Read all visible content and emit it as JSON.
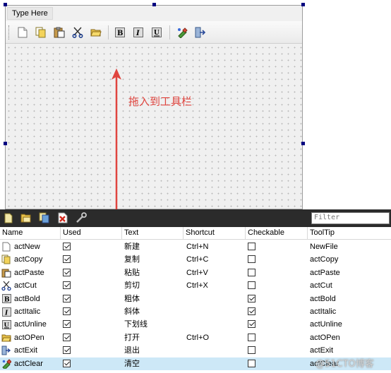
{
  "designer": {
    "menu_placeholder": "Type Here",
    "toolbar_icons": [
      "new-file-icon",
      "copy-icon",
      "paste-icon",
      "cut-icon",
      "open-folder-icon",
      "bold-icon",
      "italic-icon",
      "underline-icon",
      "clear-icon",
      "exit-icon"
    ]
  },
  "annotation": {
    "text": "拖入到工具栏",
    "color": "#e0453f"
  },
  "action_editor": {
    "toolbar_icons": [
      "new-action-icon",
      "open-icon",
      "copy-action-icon",
      "delete-icon",
      "configure-icon"
    ],
    "filter_placeholder": "Filter",
    "columns": [
      "Name",
      "Used",
      "Text",
      "Shortcut",
      "Checkable",
      "ToolTip"
    ],
    "rows": [
      {
        "icon": "new-file-icon",
        "name": "actNew",
        "used": true,
        "text": "新建",
        "shortcut": "Ctrl+N",
        "checkable": false,
        "tooltip": "NewFile"
      },
      {
        "icon": "copy-icon",
        "name": "actCopy",
        "used": true,
        "text": "复制",
        "shortcut": "Ctrl+C",
        "checkable": false,
        "tooltip": "actCopy"
      },
      {
        "icon": "paste-icon",
        "name": "actPaste",
        "used": true,
        "text": "粘贴",
        "shortcut": "Ctrl+V",
        "checkable": false,
        "tooltip": "actPaste"
      },
      {
        "icon": "cut-icon",
        "name": "actCut",
        "used": true,
        "text": "剪切",
        "shortcut": "Ctrl+X",
        "checkable": false,
        "tooltip": "actCut"
      },
      {
        "icon": "bold-icon",
        "name": "actBold",
        "used": true,
        "text": "粗体",
        "shortcut": "",
        "checkable": true,
        "tooltip": "actBold"
      },
      {
        "icon": "italic-icon",
        "name": "actItalic",
        "used": true,
        "text": "斜体",
        "shortcut": "",
        "checkable": true,
        "tooltip": "actItalic"
      },
      {
        "icon": "underline-icon",
        "name": "actUnline",
        "used": true,
        "text": "下划线",
        "shortcut": "",
        "checkable": true,
        "tooltip": "actUnline"
      },
      {
        "icon": "open-folder-icon",
        "name": "actOPen",
        "used": true,
        "text": "打开",
        "shortcut": "Ctrl+O",
        "checkable": false,
        "tooltip": "actOPen"
      },
      {
        "icon": "exit-icon",
        "name": "actExit",
        "used": true,
        "text": "退出",
        "shortcut": "",
        "checkable": false,
        "tooltip": "actExit"
      },
      {
        "icon": "clear-icon",
        "name": "actClear",
        "used": true,
        "text": "清空",
        "shortcut": "",
        "checkable": false,
        "tooltip": "actClear",
        "selected": true
      }
    ]
  },
  "watermark": "@51CTO博客",
  "colors": {
    "selection": "#cde8f7",
    "handle": "#000080",
    "annotation": "#e0453f"
  }
}
